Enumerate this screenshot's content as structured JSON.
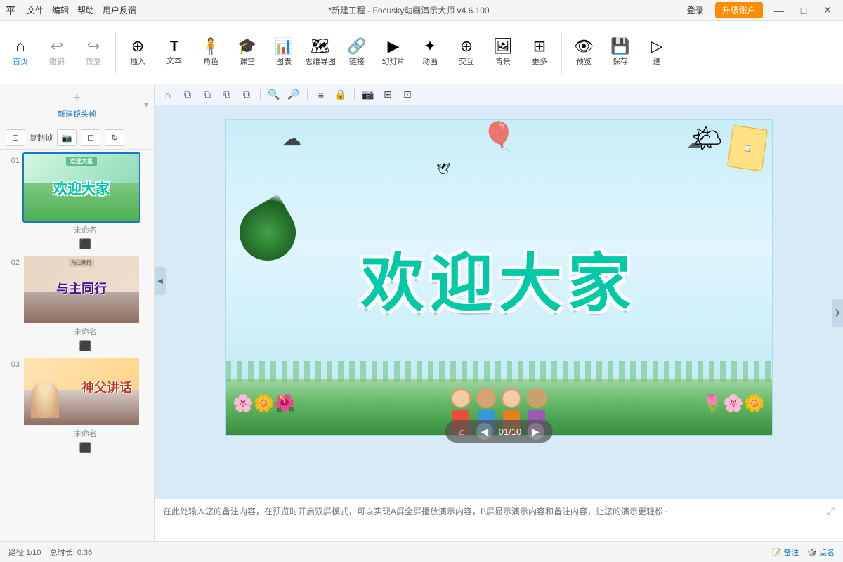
{
  "titlebar": {
    "logo": "平",
    "menu": [
      "文件",
      "编辑",
      "帮助",
      "用户反馈"
    ],
    "title": "*新建工程 - Focusky动画演示大师 v4.6.100",
    "login": "登录",
    "upgrade": "升级账户",
    "min": "—",
    "max": "□",
    "close": "✕"
  },
  "toolbar": {
    "items": [
      {
        "icon": "⌂",
        "label": "首页",
        "active": true
      },
      {
        "icon": "↩",
        "label": "撤销",
        "disabled": true
      },
      {
        "icon": "↪",
        "label": "恢复",
        "disabled": true
      },
      {
        "icon": "+",
        "label": "插入"
      },
      {
        "icon": "T",
        "label": "文本"
      },
      {
        "icon": "👤",
        "label": "角色"
      },
      {
        "icon": "🎓",
        "label": "课堂"
      },
      {
        "icon": "📊",
        "label": "图表"
      },
      {
        "icon": "🗺",
        "label": "思维导图"
      },
      {
        "icon": "🔗",
        "label": "链接"
      },
      {
        "icon": "▶",
        "label": "幻灯片"
      },
      {
        "icon": "✨",
        "label": "动画"
      },
      {
        "icon": "⊕",
        "label": "交互"
      },
      {
        "icon": "🖼",
        "label": "背景"
      },
      {
        "icon": "⊞",
        "label": "更多"
      },
      {
        "icon": "👁",
        "label": "预览"
      },
      {
        "icon": "💾",
        "label": "保存"
      },
      {
        "icon": "▷",
        "label": "进"
      }
    ]
  },
  "slide_panel": {
    "new_frame_label": "新建镜头帧",
    "copy_btn": "复制帧",
    "slides": [
      {
        "num": "01",
        "title": "欢迎大家",
        "name": "未命名",
        "active": true
      },
      {
        "num": "02",
        "title": "与主同行",
        "name": "未命名",
        "active": false
      },
      {
        "num": "03",
        "title": "神父讲话",
        "name": "未命名",
        "active": false
      }
    ]
  },
  "canvas": {
    "main_text": "欢迎大家",
    "top_right_card": "卡片"
  },
  "navigation": {
    "home_icon": "⌂",
    "prev": "◀",
    "counter": "01/10",
    "next": "▶"
  },
  "notes": {
    "placeholder": "在此处输入您的备注内容，在预览时开启双屏模式，可以实现A屏全屏播放演示内容，B屏显示演示内容和备注内容，让您的演示更轻松~"
  },
  "statusbar": {
    "path": "路径 1/10",
    "total": "总时长: 0:36",
    "notes_btn": "备注",
    "callname_btn": "点名"
  },
  "canvas_toolbar": {
    "tools": [
      "⌂",
      "⧉",
      "⧉",
      "⧉",
      "⧉",
      "🔍",
      "🔍",
      "—",
      "≡",
      "🔒",
      "⊡",
      "📷",
      "⊞",
      "⊡"
    ]
  }
}
